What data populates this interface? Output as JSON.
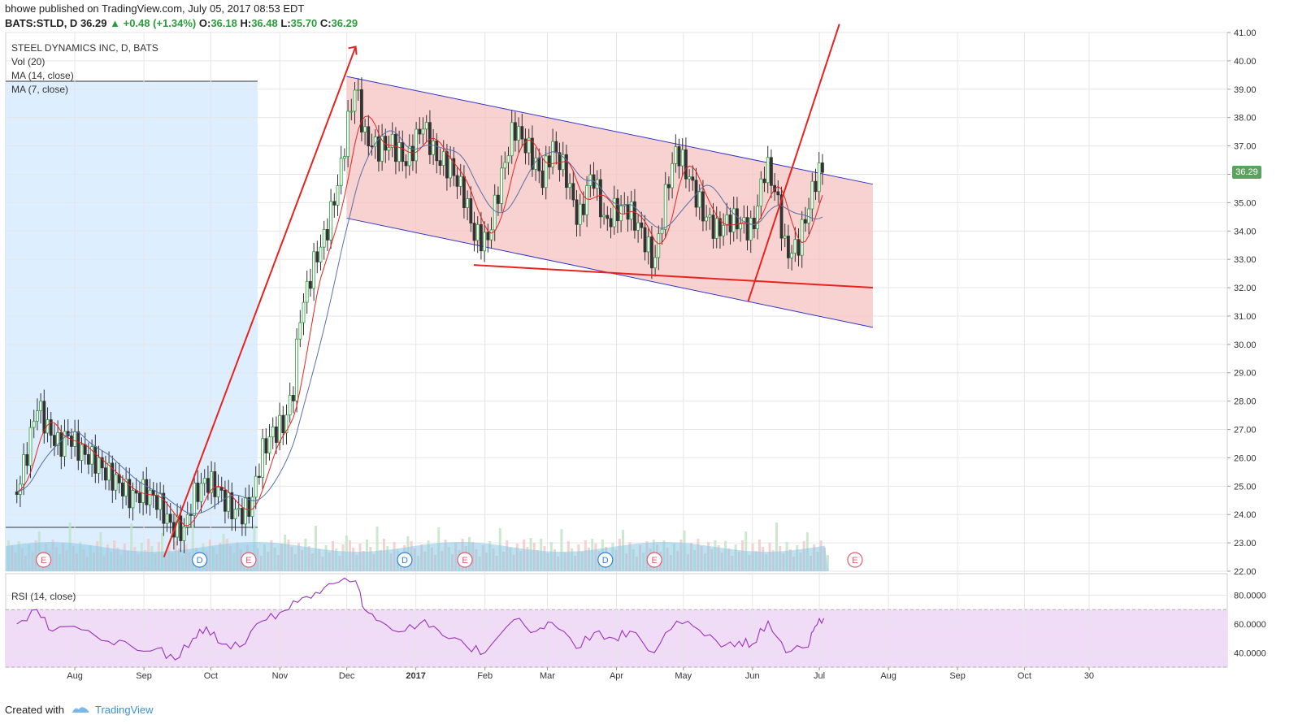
{
  "header": {
    "line1": "bhowe published on TradingView.com, July 05, 2017 08:53 EDT",
    "symbol": "BATS:STLD, D",
    "last": "36.29",
    "change": "+0.48 (+1.34%)",
    "open_label": "O:",
    "open": "36.18",
    "high_label": "H:",
    "high": "36.48",
    "low_label": "L:",
    "low": "35.70",
    "close_label": "C:",
    "close": "36.29"
  },
  "legend": {
    "title": "STEEL DYNAMICS INC, D, BATS",
    "vol": "Vol (20)",
    "ma14": "MA (14, close)",
    "ma7": "MA (7, close)",
    "rsi": "RSI (14, close)"
  },
  "footer": {
    "created": "Created with",
    "brand": "TradingView"
  },
  "colors": {
    "up": "#2a9d3a",
    "down": "#333333",
    "channel_fill": "#f6c2c2",
    "channel_line": "#3333cc",
    "trend": "#e8231f",
    "ma_fast": "#e8231f",
    "ma_slow": "#5a6fa8",
    "shade": "#dceeff",
    "rsi_band": "#f1dcf7",
    "rsi_line": "#9933bb",
    "grid": "#e6e6e6"
  },
  "chart_data": {
    "type": "candlestick",
    "price_axis": [
      "41.00",
      "40.00",
      "39.00",
      "38.00",
      "37.00",
      "36.00",
      "35.00",
      "34.00",
      "33.00",
      "32.00",
      "31.00",
      "30.00",
      "29.00",
      "28.00",
      "27.00",
      "26.00",
      "25.00",
      "24.00",
      "23.00",
      "22.00"
    ],
    "price_range": [
      22,
      41
    ],
    "last_price_badge": "36.29",
    "rsi_axis": [
      "80.0000",
      "60.0000",
      "40.0000"
    ],
    "rsi_range": [
      30,
      95
    ],
    "rsi_bands": [
      70,
      30
    ],
    "time_axis": [
      "Aug",
      "Sep",
      "Oct",
      "Nov",
      "Dec",
      "2017",
      "Feb",
      "Mar",
      "Apr",
      "May",
      "Jun",
      "Jul",
      "Aug",
      "Sep",
      "Oct",
      "30"
    ],
    "events": [
      {
        "label": "E",
        "kind": "earnings",
        "date": "2016-07-18"
      },
      {
        "label": "D",
        "kind": "dividend",
        "date": "2016-09-26"
      },
      {
        "label": "E",
        "kind": "earnings",
        "date": "2016-10-18"
      },
      {
        "label": "D",
        "kind": "dividend",
        "date": "2016-12-27"
      },
      {
        "label": "E",
        "kind": "earnings",
        "date": "2017-01-23"
      },
      {
        "label": "D",
        "kind": "dividend",
        "date": "2017-03-27"
      },
      {
        "label": "E",
        "kind": "earnings",
        "date": "2017-04-18"
      },
      {
        "label": "E",
        "kind": "earnings",
        "date": "2017-07-17"
      }
    ],
    "drawings": {
      "channel_upper": [
        [
          "2016-12-01",
          39.45
        ],
        [
          "2017-07-25",
          35.65
        ]
      ],
      "channel_lower": [
        [
          "2016-12-01",
          34.45
        ],
        [
          "2017-07-25",
          30.6
        ]
      ],
      "horizontal_support": [
        [
          "2017-01-27",
          32.8
        ],
        [
          "2017-07-25",
          32.0
        ]
      ],
      "arrow_rally": [
        [
          "2016-09-10",
          22.5
        ],
        [
          "2016-12-05",
          40.5
        ]
      ],
      "breakout_line": [
        [
          "2017-05-30",
          31.5
        ],
        [
          "2017-07-10",
          41.3
        ]
      ]
    },
    "series": [
      {
        "name": "price",
        "points": [
          [
            "2016-07-06",
            24.8
          ],
          [
            "2016-07-11",
            26.3
          ],
          [
            "2016-07-15",
            27.9
          ],
          [
            "2016-07-20",
            27.0
          ],
          [
            "2016-07-25",
            26.4
          ],
          [
            "2016-07-29",
            26.8
          ],
          [
            "2016-08-04",
            26.2
          ],
          [
            "2016-08-10",
            25.9
          ],
          [
            "2016-08-16",
            25.4
          ],
          [
            "2016-08-22",
            25.0
          ],
          [
            "2016-08-26",
            24.6
          ],
          [
            "2016-09-01",
            24.8
          ],
          [
            "2016-09-07",
            24.5
          ],
          [
            "2016-09-13",
            23.6
          ],
          [
            "2016-09-19",
            23.4
          ],
          [
            "2016-09-23",
            24.6
          ],
          [
            "2016-09-29",
            25.2
          ],
          [
            "2016-10-04",
            24.9
          ],
          [
            "2016-10-10",
            24.2
          ],
          [
            "2016-10-14",
            24.0
          ],
          [
            "2016-10-19",
            24.3
          ],
          [
            "2016-10-24",
            26.2
          ],
          [
            "2016-10-28",
            26.8
          ],
          [
            "2016-11-03",
            27.2
          ],
          [
            "2016-11-07",
            28.4
          ],
          [
            "2016-11-10",
            31.0
          ],
          [
            "2016-11-16",
            32.8
          ],
          [
            "2016-11-22",
            34.0
          ],
          [
            "2016-11-28",
            36.0
          ],
          [
            "2016-12-01",
            37.6
          ],
          [
            "2016-12-05",
            39.2
          ],
          [
            "2016-12-09",
            37.3
          ],
          [
            "2016-12-15",
            36.9
          ],
          [
            "2016-12-21",
            37.1
          ],
          [
            "2016-12-28",
            36.4
          ],
          [
            "2017-01-04",
            37.8
          ],
          [
            "2017-01-10",
            36.6
          ],
          [
            "2017-01-17",
            36.2
          ],
          [
            "2017-01-23",
            35.2
          ],
          [
            "2017-01-27",
            33.9
          ],
          [
            "2017-02-02",
            33.6
          ],
          [
            "2017-02-08",
            35.8
          ],
          [
            "2017-02-14",
            37.7
          ],
          [
            "2017-02-21",
            36.8
          ],
          [
            "2017-02-27",
            35.8
          ],
          [
            "2017-03-03",
            37.0
          ],
          [
            "2017-03-09",
            36.1
          ],
          [
            "2017-03-15",
            34.3
          ],
          [
            "2017-03-21",
            36.1
          ],
          [
            "2017-03-27",
            34.2
          ],
          [
            "2017-03-31",
            34.7
          ],
          [
            "2017-04-06",
            34.8
          ],
          [
            "2017-04-12",
            34.0
          ],
          [
            "2017-04-18",
            32.8
          ],
          [
            "2017-04-24",
            35.7
          ],
          [
            "2017-04-28",
            36.9
          ],
          [
            "2017-05-04",
            35.8
          ],
          [
            "2017-05-10",
            34.6
          ],
          [
            "2017-05-16",
            34.0
          ],
          [
            "2017-05-22",
            34.4
          ],
          [
            "2017-05-26",
            34.3
          ],
          [
            "2017-06-01",
            34.0
          ],
          [
            "2017-06-07",
            36.4
          ],
          [
            "2017-06-12",
            35.2
          ],
          [
            "2017-06-16",
            33.2
          ],
          [
            "2017-06-21",
            33.4
          ],
          [
            "2017-06-26",
            34.8
          ],
          [
            "2017-06-29",
            35.8
          ],
          [
            "2017-07-03",
            36.29
          ]
        ]
      },
      {
        "name": "rsi",
        "points": [
          [
            "2016-07-06",
            60
          ],
          [
            "2016-07-15",
            70
          ],
          [
            "2016-07-22",
            55
          ],
          [
            "2016-08-04",
            56
          ],
          [
            "2016-08-16",
            48
          ],
          [
            "2016-08-26",
            45
          ],
          [
            "2016-09-07",
            43
          ],
          [
            "2016-09-15",
            35
          ],
          [
            "2016-09-23",
            50
          ],
          [
            "2016-09-29",
            58
          ],
          [
            "2016-10-06",
            46
          ],
          [
            "2016-10-14",
            44
          ],
          [
            "2016-10-24",
            62
          ],
          [
            "2016-11-01",
            68
          ],
          [
            "2016-11-09",
            75
          ],
          [
            "2016-11-17",
            82
          ],
          [
            "2016-11-25",
            88
          ],
          [
            "2016-12-05",
            90
          ],
          [
            "2016-12-09",
            70
          ],
          [
            "2016-12-16",
            62
          ],
          [
            "2016-12-27",
            55
          ],
          [
            "2017-01-05",
            63
          ],
          [
            "2017-01-13",
            52
          ],
          [
            "2017-01-24",
            44
          ],
          [
            "2017-02-01",
            40
          ],
          [
            "2017-02-14",
            63
          ],
          [
            "2017-02-24",
            55
          ],
          [
            "2017-03-03",
            61
          ],
          [
            "2017-03-14",
            43
          ],
          [
            "2017-03-22",
            54
          ],
          [
            "2017-03-31",
            50
          ],
          [
            "2017-04-07",
            55
          ],
          [
            "2017-04-18",
            40
          ],
          [
            "2017-04-28",
            62
          ],
          [
            "2017-05-08",
            56
          ],
          [
            "2017-05-18",
            44
          ],
          [
            "2017-05-26",
            48
          ],
          [
            "2017-06-01",
            46
          ],
          [
            "2017-06-08",
            62
          ],
          [
            "2017-06-16",
            40
          ],
          [
            "2017-06-26",
            44
          ],
          [
            "2017-06-29",
            58
          ],
          [
            "2017-07-03",
            64
          ]
        ]
      }
    ]
  }
}
